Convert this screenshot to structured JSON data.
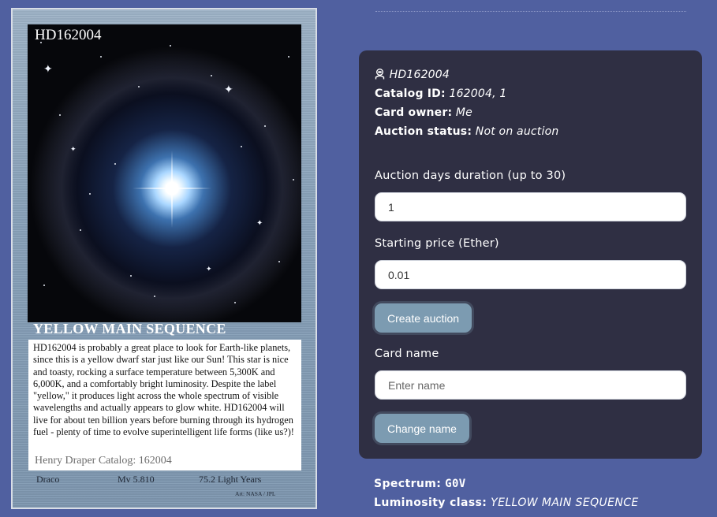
{
  "card": {
    "title": "HD162004",
    "luminosity_class_banner": "YELLOW MAIN SEQUENCE",
    "description": "HD162004 is probably a great place to look for Earth-like planets, since this is a yellow dwarf star just like our Sun! This star is nice and toasty, rocking a surface temperature between 5,300K and 6,000K, and a comfortably bright luminosity. Despite the label \"yellow,\" it produces light across the whole spectrum of visible wavelengths and actually appears to glow white. HD162004 will live for about ten billion years before burning through its hydrogen fuel - plenty of time to evolve superintelligent life forms (like us?)!",
    "catalog_line": "Henry Draper Catalog: 162004",
    "constellation": "Draco",
    "magnitude": "Mv 5.810",
    "distance": "75.2 Light Years",
    "art_credit": "Art: NASA / JPL"
  },
  "details": {
    "star_icon": "astronaut-icon",
    "star_name": "HD162004",
    "catalog_id_label": "Catalog ID:",
    "catalog_id_value": "162004, 1",
    "owner_label": "Card owner:",
    "owner_value": "Me",
    "auction_status_label": "Auction status:",
    "auction_status_value": "Not on auction"
  },
  "auction_form": {
    "duration_label": "Auction days duration (up to 30)",
    "duration_value": "1",
    "price_label": "Starting price (Ether)",
    "price_value": "0.01",
    "create_button": "Create auction"
  },
  "rename_form": {
    "name_label": "Card name",
    "name_placeholder": "Enter name",
    "change_button": "Change name"
  },
  "properties": {
    "spectrum_label": "Spectrum:",
    "spectrum_value": "G0V",
    "luminosity_label": "Luminosity class:",
    "luminosity_value": "YELLOW MAIN SEQUENCE"
  },
  "colors": {
    "page_background": "#5060a0",
    "panel_background": "#2f2f43",
    "button_background": "#7c9bb1"
  }
}
